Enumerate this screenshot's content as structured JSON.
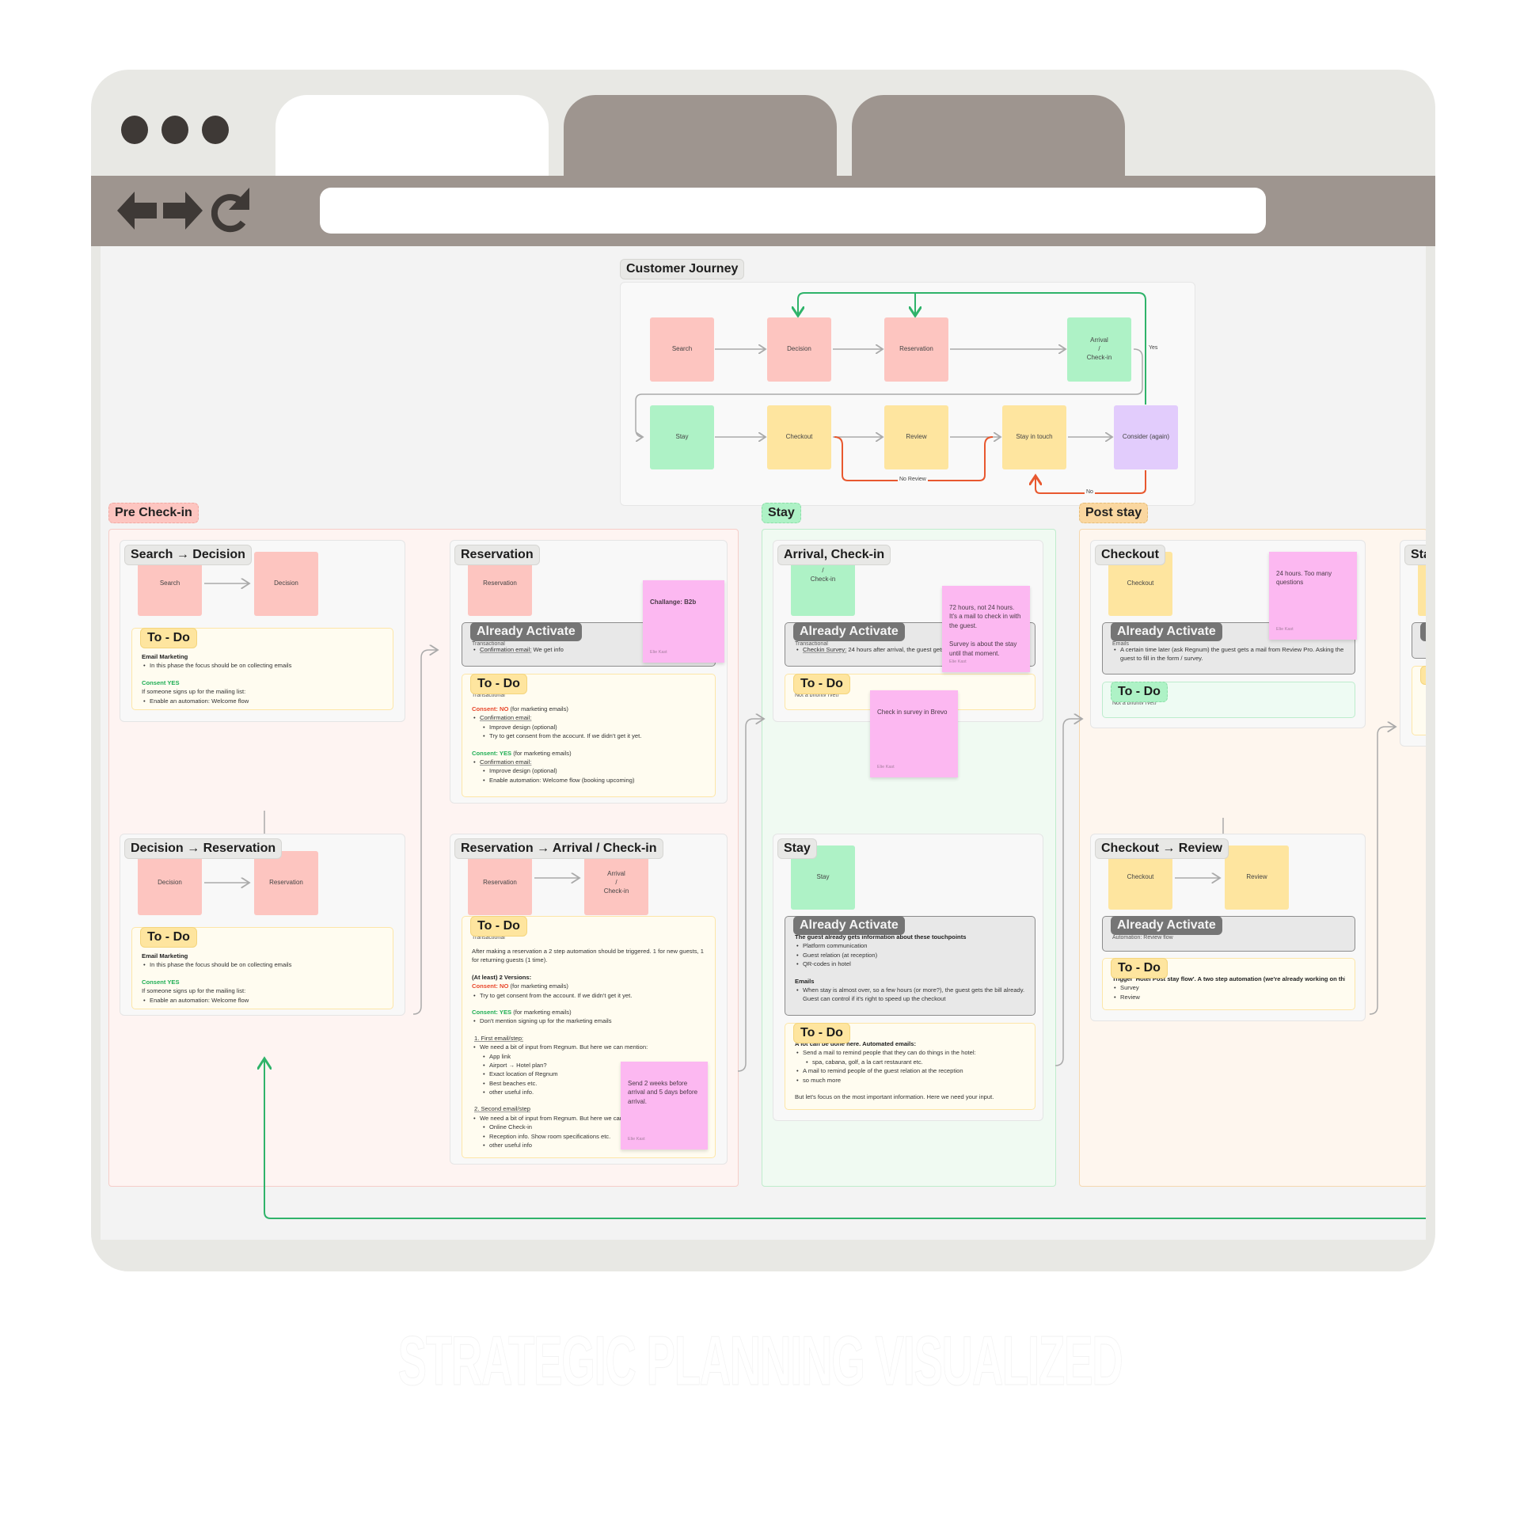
{
  "browser": {
    "tabs": [
      {
        "label": "",
        "active": true
      },
      {
        "label": "",
        "active": false
      },
      {
        "label": "",
        "active": false
      }
    ],
    "nav": {
      "back_icon": "back-arrow-icon",
      "forward_icon": "forward-arrow-icon",
      "reload_icon": "reload-icon"
    },
    "url": ""
  },
  "colors": {
    "pink_node": "#fdc5c0",
    "green_node": "#aef2c6",
    "yellow_node": "#fee59f",
    "purple_node": "#e2ccfc",
    "sticky": "#fcb8f1",
    "loop_green": "#2fb36a",
    "no_red": "#e8582f",
    "arrow_gray": "#aaaaaa"
  },
  "journey": {
    "title": "Customer Journey",
    "nodes": {
      "search": "Search",
      "decision": "Decision",
      "reservation": "Reservation",
      "arrival": "Arrival\n/\nCheck-in",
      "stay": "Stay",
      "checkout": "Checkout",
      "review": "Review",
      "stay_in_touch": "Stay in touch",
      "consider": "Consider (again)"
    },
    "edge_labels": {
      "yes": "Yes",
      "no_review": "No Review",
      "no": "No"
    }
  },
  "sections": {
    "pre": {
      "label": "Pre Check-in",
      "search_decision": {
        "title": "Search → Decision",
        "from": "Search",
        "to": "Decision",
        "todo": {
          "chip": "To - Do",
          "heading": "Email Marketing",
          "bullet1": "In this phase the focus should be on collecting emails",
          "consent": "Consent YES",
          "line": "If someone signs up for the mailing list:",
          "bullet2": "Enable an automation: Welcome flow"
        }
      },
      "decision_reservation": {
        "title": "Decision → Reservation",
        "from": "Decision",
        "to": "Reservation",
        "todo": {
          "chip": "To - Do",
          "heading": "Email Marketing",
          "bullet1": "In this phase the focus should be on collecting emails",
          "consent": "Consent YES",
          "line": "If someone signs up for the mailing list:",
          "bullet2": "Enable an automation: Welcome flow"
        }
      },
      "reservation": {
        "title": "Reservation",
        "node": "Reservation",
        "sticky": {
          "text": "Challange: B2b",
          "author": "Elie Kast"
        },
        "active": {
          "chip": "Already Activate",
          "hidden": "Transactional",
          "item_label": "Confirmation email:",
          "item_text": " We get info"
        },
        "todo": {
          "chip": "To - Do",
          "hidden": "Transactional",
          "no_label": "Consent: NO",
          "no_suffix": " (for marketing emails)",
          "no_item": "Confirmation email:",
          "no_sub1": "Improve design (optional)",
          "no_sub2": "Try to get consent from the acocunt. If we didn't get it yet.",
          "yes_label": "Consent: YES",
          "yes_suffix": " (for marketing emails)",
          "yes_item": "Confirmation email:",
          "yes_sub1": "Improve design (optional)",
          "yes_sub2": "Enable automation: Welcome flow (booking upcoming)"
        }
      },
      "reservation_arrival": {
        "title": "Reservation → Arrival / Check-in",
        "from": "Reservation",
        "to": "Arrival\n/\nCheck-in",
        "sticky": {
          "text": "Send 2 weeks before arrival and 5 days before arrival.",
          "author": "Elie Kast"
        },
        "todo": {
          "chip": "To - Do",
          "hidden": "Transactional",
          "intro": "After making a reservation a 2 step automation should be triggered. 1 for new guests, 1 for returning guests (1 time).",
          "versions": "(At least) 2 Versions:",
          "no_label": "Consent: NO",
          "no_suffix": " (for marketing emails)",
          "no_item": "Try to get consent from the account. If we didn't get it yet.",
          "yes_label": "Consent: YES",
          "yes_suffix": " (for marketing emails)",
          "yes_item": "Don't mention signing up for the marketing emails",
          "step1": "1. First email/step:",
          "step1_intro": "We need a bit of input from Regnum. But here we can mention:",
          "step1_items": [
            "App link",
            "Airport → Hotel plan?",
            "Exact location of Regnum",
            "Best beaches etc.",
            "other useful info."
          ],
          "step2": "2. Second email/step",
          "step2_intro": "We need a bit of input from Regnum. But here we can mention:",
          "step2_items": [
            "Online Check-in",
            "Reception info. Show room specifications etc.",
            "other useful info"
          ]
        }
      }
    },
    "stay": {
      "label": "Stay",
      "arrival": {
        "title": "Arrival, Check-in",
        "node": "Arrival\n/\nCheck-in",
        "sticky1": {
          "text": "72 hours, not 24 hours.\nIt's a mail to check in with the guest.\n\nSurvey is about the stay until that moment.",
          "author": "Elie Kast"
        },
        "sticky2": {
          "text": "Check in survey in Brevo",
          "author": "Elie Kast"
        },
        "active": {
          "chip": "Already Activate",
          "hidden": "Transactional",
          "item_label": "Checkin Survey:",
          "item_text": " 24 hours after arrival, the guest gets a survey"
        },
        "todo": {
          "chip": "To - Do",
          "hidden": "Not a priority (yet)"
        }
      },
      "stay_card": {
        "title": "Stay",
        "node": "Stay",
        "active": {
          "chip": "Already Activate",
          "heading": "The guest already gets information about these touchpoints",
          "items": [
            "Platform communication",
            "Guest relation (at reception)",
            "QR-codes in hotel"
          ],
          "emails": "Emails",
          "email_item": "When stay is almost over, so a few hours (or more?), the guest gets the bill already. Guest can control if it's right to speed up the checkout"
        },
        "todo": {
          "chip": "To - Do",
          "heading": "A lot can be done here. Automated emails:",
          "item1": "Send a mail to remind people that they can do things in the hotel:",
          "item1_sub": "spa, cabana, golf, a la cart restaurant etc.",
          "item2": "A mail to remind people of the guest relation at the reception",
          "item3": "so much more",
          "footer": "But let's focus on the most important information. Here we need your input."
        }
      }
    },
    "post": {
      "label": "Post stay",
      "checkout": {
        "title": "Checkout",
        "node": "Checkout",
        "sticky": {
          "text": "24 hours. Too many questions",
          "author": "Elie Kast"
        },
        "active": {
          "chip": "Already Activate",
          "hidden": "Emails",
          "item": "A certain time later (ask Regnum) the guest gets a mail from Review Pro. Asking the guest to fill in the form / survey."
        },
        "todo": {
          "chip": "To - Do",
          "hidden": "Not a priority (yet)"
        }
      },
      "checkout_review": {
        "title": "Checkout → Review",
        "from": "Checkout",
        "to": "Review",
        "active": {
          "chip": "Already Activate",
          "hidden": "Automation: Review flow"
        },
        "todo": {
          "chip": "To - Do",
          "heading": "Trigger 'Hotel Post stay flow'. A two step automation (we're already working on this.",
          "items": [
            "Survey",
            "Review"
          ]
        }
      },
      "next": {
        "title": "Stay in touch"
      }
    }
  },
  "tagline": "STRATEGIC PLANNING VISUALIZED"
}
